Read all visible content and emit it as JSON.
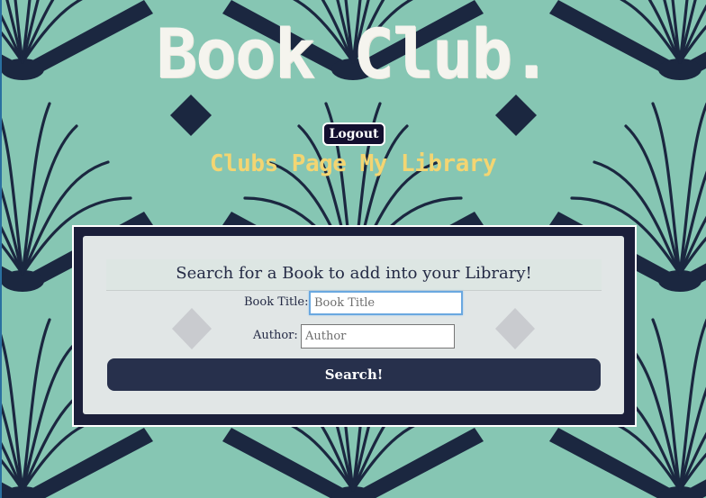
{
  "site": {
    "title": "Book Club."
  },
  "header": {
    "logout_label": "Logout"
  },
  "nav": {
    "items": [
      {
        "label": "Clubs Page"
      },
      {
        "label": "My Library"
      }
    ]
  },
  "search": {
    "heading": "Search for a Book to add into your Library!",
    "book_title_label": "Book Title:",
    "book_title_placeholder": "Book Title",
    "book_title_value": "",
    "author_label": "Author:",
    "author_placeholder": "Author",
    "author_value": "",
    "submit_label": "Search!"
  },
  "theme": {
    "background": "#86c6b3",
    "book_color": "#1b2740",
    "title_color": "#f5f4ee",
    "nav_color": "#f3d572",
    "button_color": "#27304c",
    "logout_bg": "#130f2f"
  },
  "icons": {
    "background_pattern": "open-book-icon",
    "diamond": "diamond-icon"
  }
}
